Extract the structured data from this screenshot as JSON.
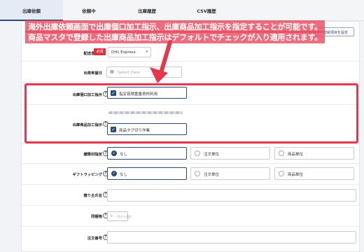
{
  "tabs": [
    {
      "label": "出庫依頼"
    },
    {
      "label": "依頼中"
    },
    {
      "label": "出庫履歴"
    },
    {
      "label": "CSV履歴"
    }
  ],
  "annotation": {
    "line1": "海外出庫依頼画面で出庫個口加工指示、出庫商品加工指示を指定することが可能です。",
    "line2": "商品マスタで登録した出庫商品加工指示はデフォルトでチェックが入り適用されます。"
  },
  "register_item_button": "登録項目を設定",
  "form": {
    "shipping_method": {
      "label": "配送便指定",
      "required": "必須",
      "value": "DHL Express"
    },
    "shipping_date": {
      "label": "出荷希望日",
      "placeholder": "Select Date"
    },
    "package_instruction": {
      "label": "出庫個口加工指示",
      "option": "指定容積重量資材利用"
    },
    "product_instruction": {
      "label": "出庫商品加工指示",
      "option": "商品タグ切り作業"
    },
    "cushioning": {
      "label": "緩衝材指定",
      "options": [
        "なし",
        "注文単位",
        "商品単位"
      ]
    },
    "gift_wrapping": {
      "label": "ギフトラッピング",
      "options": [
        "なし",
        "注文単位",
        "商品単位"
      ]
    },
    "sender_name": {
      "label": "贈り主氏名"
    },
    "enclosure": {
      "label": "同梱物",
      "button": "一覧から選択"
    },
    "order_number": {
      "label": "注文番号"
    }
  }
}
